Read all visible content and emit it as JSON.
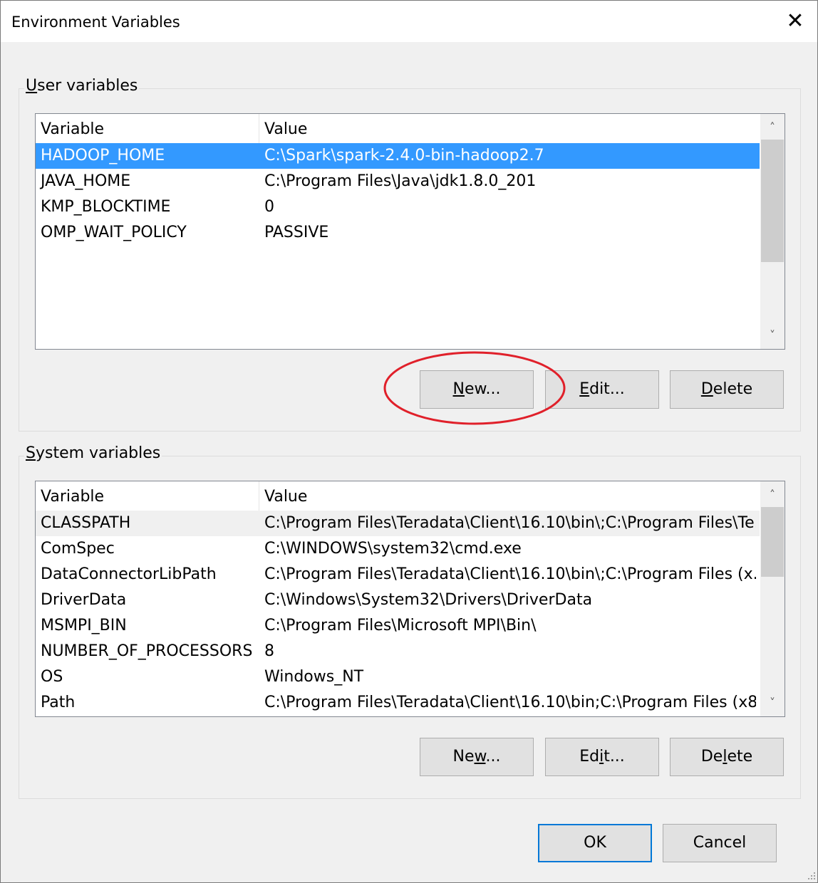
{
  "window": {
    "title": "Environment Variables",
    "close_glyph": "✕"
  },
  "user_section": {
    "title": "User variables",
    "title_mnemonic": "U",
    "title_rest": "ser variables",
    "columns": [
      "Variable",
      "Value"
    ],
    "rows": [
      {
        "name": "HADOOP_HOME",
        "value": "C:\\Spark\\spark-2.4.0-bin-hadoop2.7",
        "selected": true
      },
      {
        "name": "JAVA_HOME",
        "value": "C:\\Program Files\\Java\\jdk1.8.0_201"
      },
      {
        "name": "KMP_BLOCKTIME",
        "value": "0"
      },
      {
        "name": "OMP_WAIT_POLICY",
        "value": "PASSIVE"
      }
    ],
    "buttons": {
      "new": {
        "mn": "N",
        "rest": "ew..."
      },
      "edit": {
        "mn": "E",
        "rest": "dit..."
      },
      "delete": {
        "mn": "D",
        "rest": "elete"
      }
    }
  },
  "system_section": {
    "title": "System variables",
    "title_mnemonic": "S",
    "title_rest": "ystem variables",
    "columns": [
      "Variable",
      "Value"
    ],
    "rows": [
      {
        "name": "CLASSPATH",
        "value": "C:\\Program Files\\Teradata\\Client\\16.10\\bin\\;C:\\Program Files\\Te...",
        "focused": true
      },
      {
        "name": "ComSpec",
        "value": "C:\\WINDOWS\\system32\\cmd.exe"
      },
      {
        "name": "DataConnectorLibPath",
        "value": "C:\\Program Files\\Teradata\\Client\\16.10\\bin\\;C:\\Program Files (x..."
      },
      {
        "name": "DriverData",
        "value": "C:\\Windows\\System32\\Drivers\\DriverData"
      },
      {
        "name": "MSMPI_BIN",
        "value": "C:\\Program Files\\Microsoft MPI\\Bin\\"
      },
      {
        "name": "NUMBER_OF_PROCESSORS",
        "value": "8"
      },
      {
        "name": "OS",
        "value": "Windows_NT"
      },
      {
        "name": "Path",
        "value": "C:\\Program Files\\Teradata\\Client\\16.10\\bin;C:\\Program Files (x8..."
      }
    ],
    "buttons": {
      "new": {
        "pre": "Ne",
        "mn": "w",
        "rest": "..."
      },
      "edit": {
        "pre": "Ed",
        "mn": "i",
        "rest": "t..."
      },
      "delete": {
        "pre": "De",
        "mn": "l",
        "rest": "ete"
      }
    }
  },
  "footer": {
    "ok_label": "OK",
    "cancel_label": "Cancel"
  },
  "scroll": {
    "up_glyph": "˄",
    "down_glyph": "˅"
  },
  "colors": {
    "selection": "#3399ff",
    "annotation": "#e0202a",
    "default_button_border": "#0078d7"
  },
  "annotation": {
    "shape": "ellipse",
    "target": "user_section.buttons.new"
  }
}
